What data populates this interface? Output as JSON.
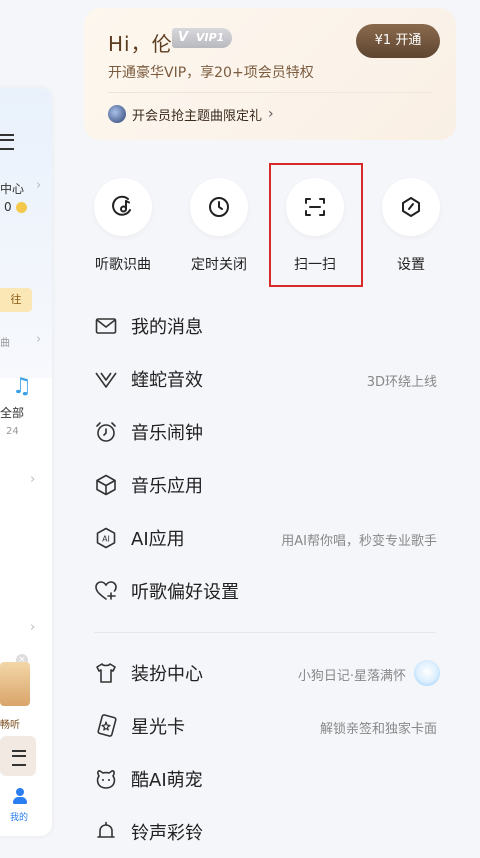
{
  "background_page": {
    "items": [
      "中心",
      "0",
      "往",
      "曲",
      "全部",
      "24",
      "畅听",
      "我的"
    ]
  },
  "vip": {
    "greeting": "Hi，伦",
    "badge": "VIP1",
    "subtitle": "开通豪华VIP，享20+项会员特权",
    "button": "¥1 开通",
    "promo": "开会员抢主题曲限定礼"
  },
  "quick_actions": [
    {
      "label": "听歌识曲",
      "icon": "music-recognition-icon"
    },
    {
      "label": "定时关闭",
      "icon": "clock-icon"
    },
    {
      "label": "扫一扫",
      "icon": "scan-icon"
    },
    {
      "label": "设置",
      "icon": "settings-icon"
    }
  ],
  "menu": [
    {
      "label": "我的消息",
      "right": "",
      "icon": "mail-icon"
    },
    {
      "label": "蝰蛇音效",
      "right": "3D环绕上线",
      "icon": "viper-sound-icon"
    },
    {
      "label": "音乐闹钟",
      "right": "",
      "icon": "alarm-clock-icon"
    },
    {
      "label": "音乐应用",
      "right": "",
      "icon": "cube-icon"
    },
    {
      "label": "AI应用",
      "right": "用AI帮你唱，秒变专业歌手",
      "icon": "ai-icon"
    },
    {
      "label": "听歌偏好设置",
      "right": "",
      "icon": "heart-settings-icon"
    },
    {
      "label": "装扮中心",
      "right": "小狗日记·星落满怀",
      "icon": "tshirt-icon"
    },
    {
      "label": "星光卡",
      "right": "解锁亲签和独家卡面",
      "icon": "star-card-icon"
    },
    {
      "label": "酷AI萌宠",
      "right": "",
      "icon": "pet-icon"
    },
    {
      "label": "铃声彩铃",
      "right": "",
      "icon": "bell-icon"
    }
  ],
  "colors": {
    "highlight": "#d62b2b",
    "vip_button": "#6e5139",
    "background": "#f5f6fa"
  }
}
